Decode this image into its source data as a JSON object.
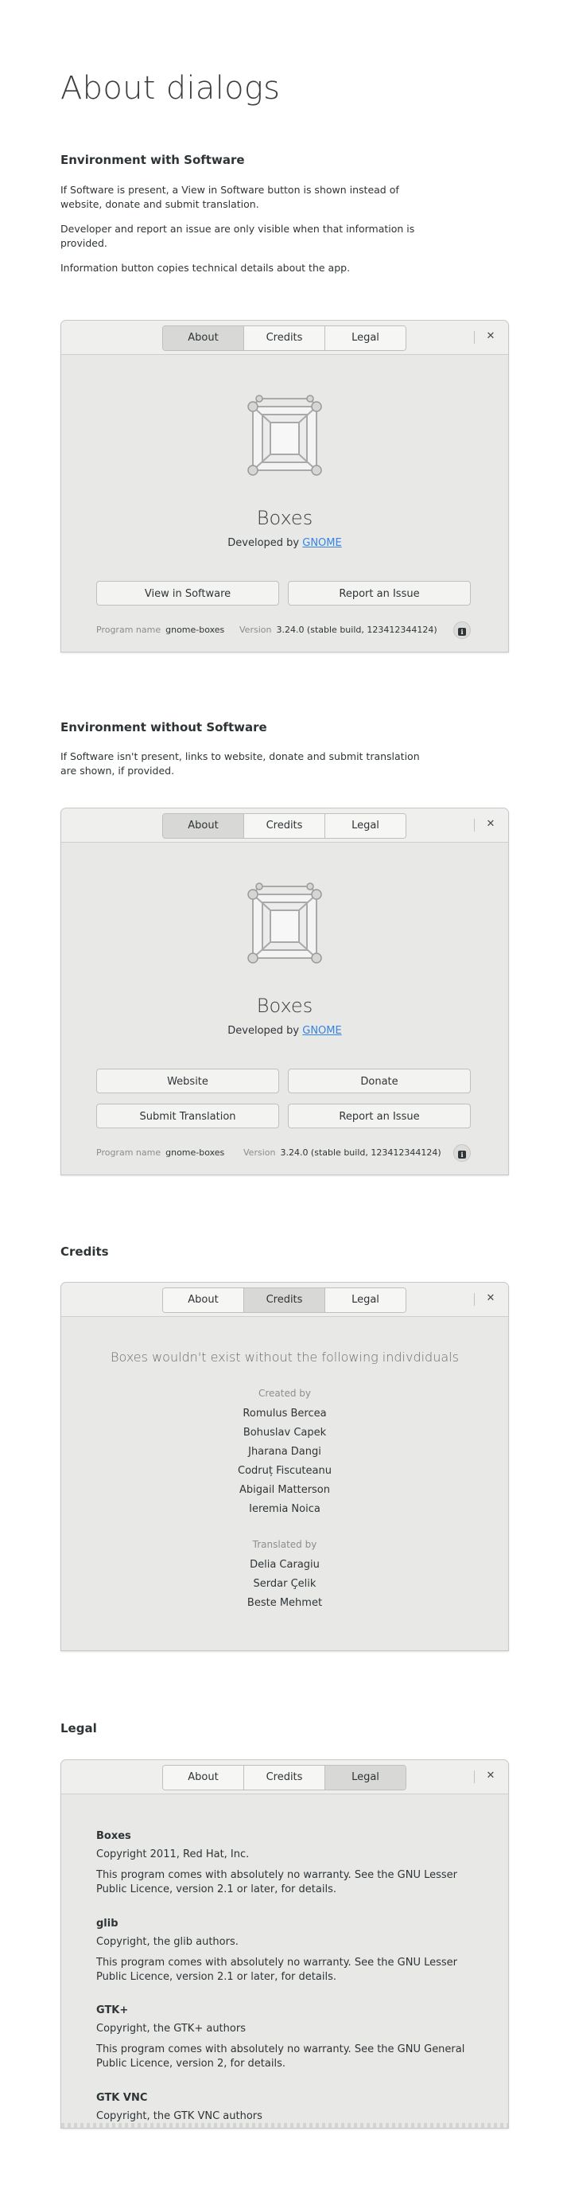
{
  "page_title": "About dialogs",
  "sections": {
    "with_software": {
      "heading": "Environment with Software",
      "paragraphs": [
        "If Software is present, a View in Software button is shown instead of website, donate and submit translation.",
        "Developer and report an issue are only visible when that information is provided.",
        "Information button copies technical details about the app."
      ]
    },
    "without_software": {
      "heading": "Environment without Software",
      "paragraphs": [
        "If Software isn't present, links to website, donate and submit translation are shown, if provided."
      ]
    },
    "credits": {
      "heading": "Credits"
    },
    "legal": {
      "heading": "Legal"
    }
  },
  "tabs": [
    "About",
    "Credits",
    "Legal"
  ],
  "close_glyph": "✕",
  "app": {
    "name": "Boxes",
    "developed_by_prefix": "Developed by ",
    "developer": "GNOME",
    "program_name_label": "Program name",
    "program_name": "gnome-boxes",
    "version_label": "Version",
    "version": "3.24.0 (stable build, 123412344124)",
    "icon": "boxes-app-icon",
    "info_icon": "info-icon",
    "info_glyph": "i"
  },
  "dialog_with_software": {
    "buttons": [
      "View in Software",
      "Report an Issue"
    ]
  },
  "dialog_without_software": {
    "buttons": [
      "Website",
      "Donate",
      "Submit Translation",
      "Report an Issue"
    ]
  },
  "credits_dialog": {
    "title": "Boxes wouldn't exist without the following indivdiduals",
    "created_by_label": "Created by",
    "created_by": [
      "Romulus Bercea",
      "Bohuslav Capek",
      "Jharana Dangi",
      "Codruț Fiscuteanu",
      "Abigail Matterson",
      "Ieremia Noica"
    ],
    "translated_by_label": "Translated by",
    "translated_by": [
      "Delia Caragiu",
      "Serdar Çelik",
      "Beste Mehmet"
    ]
  },
  "legal_dialog": {
    "entries": [
      {
        "name": "Boxes",
        "copyright": "Copyright 2011, Red Hat, Inc.",
        "license": "This program comes with absolutely no warranty. See the GNU Lesser Public Licence, version 2.1 or later, for details."
      },
      {
        "name": "glib",
        "copyright": "Copyright, the glib authors.",
        "license": "This program comes with absolutely no warranty. See the GNU Lesser Public Licence, version 2.1 or later, for details."
      },
      {
        "name": "GTK+",
        "copyright": "Copyright, the GTK+ authors",
        "license": "This program comes with absolutely no warranty. See the GNU General Public Licence, version 2, for details."
      },
      {
        "name": "GTK VNC",
        "copyright": "Copyright, the GTK VNC authors",
        "license": ""
      }
    ]
  }
}
